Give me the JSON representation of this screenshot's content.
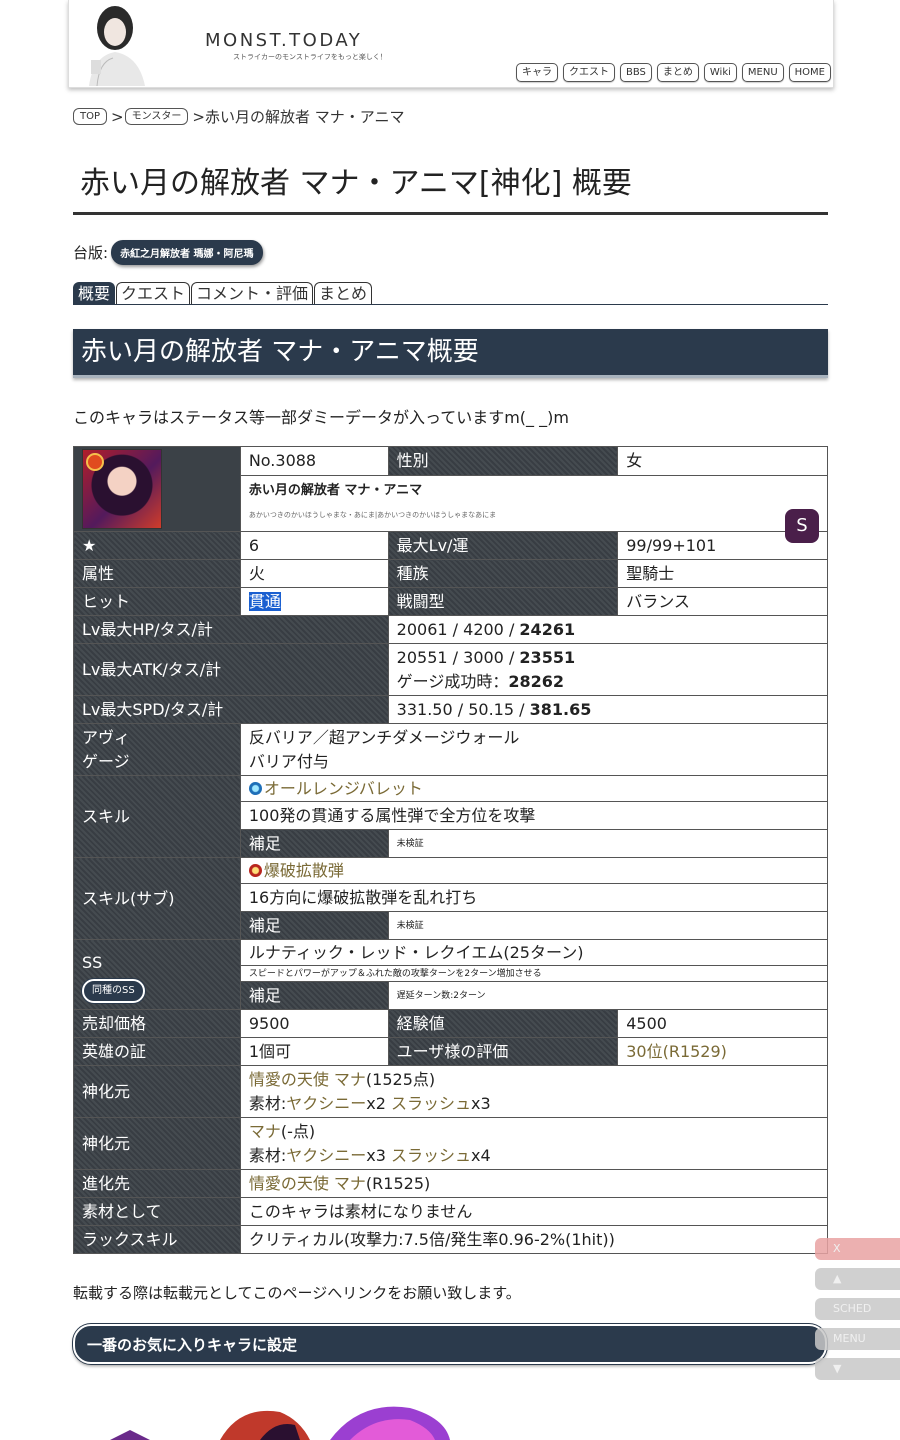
{
  "header": {
    "logo": "MONST.TODAY",
    "tagline": "ストライカーのモンストライフをもっと楽しく！",
    "nav": [
      "キャラ",
      "クエスト",
      "BBS",
      "まとめ",
      "Wiki",
      "MENU",
      "HOME"
    ]
  },
  "breadcrumb": {
    "top": "TOP",
    "sep": ">",
    "monster": "モンスター",
    "current": ">赤い月の解放者 マナ・アニマ"
  },
  "page_title": "赤い月の解放者 マナ・アニマ[神化] 概要",
  "source": {
    "label": "台版:",
    "badge": "赤紅之月解放者 瑪娜・阿尼瑪"
  },
  "tabs": [
    "概要",
    "クエスト",
    "コメント・評価",
    "まとめ"
  ],
  "section_title": "赤い月の解放者 マナ・アニマ概要",
  "notice": "このキャラはステータス等一部ダミーデータが入っていますm(_ _)m",
  "char": {
    "no": "No.3088",
    "gender_label": "性別",
    "gender": "女",
    "name": "赤い月の解放者 マナ・アニマ",
    "reading": "あかいつきのかいほうしゃまな・あにま|あかいつきのかいほうしゃまなあにま",
    "rank_badge": "S",
    "star_label": "★",
    "star": "6",
    "maxlv_label": "最大Lv/運",
    "maxlv": "99/99+101",
    "attr_label": "属性",
    "attr": "火",
    "tribe_label": "種族",
    "tribe": "聖騎士",
    "hit_label": "ヒット",
    "hit": "貫通",
    "battle_label": "戦闘型",
    "battle": "バランス",
    "hp_label": "Lv最大HP/タス/計",
    "hp_base": "20061 / 4200 / ",
    "hp_total": "24261",
    "atk_label": "Lv最大ATK/タス/計",
    "atk_base": "20551 / 3000 / ",
    "atk_total": "23551",
    "atk_gauge_label": "ゲージ成功時：",
    "atk_gauge": "28262",
    "spd_label": "Lv最大SPD/タス/計",
    "spd_base": "331.50 / 50.15 / ",
    "spd_total": "381.65",
    "ability_label_1": "アヴィ",
    "ability_label_2": "ゲージ",
    "ability_1": "反バリア／超アンチダメージウォール",
    "ability_2": "バリア付与",
    "skill_label": "スキル",
    "skill_name": "オールレンジバレット",
    "skill_desc": "100発の貫通する属性弾で全方位を攻撃",
    "supp_label": "補足",
    "skill_supp": "未検証",
    "subskill_label": "スキル(サブ)",
    "subskill_name": "爆破拡散弾",
    "subskill_desc": "16方向に爆破拡散弾を乱れ打ち",
    "subskill_supp": "未検証",
    "ss_label": "SS",
    "ss_button": "同種のSS",
    "ss_name": "ルナティック・レッド・レクイエム(25ターン)",
    "ss_desc": "スピードとパワーがアップ＆ふれた敵の攻撃ターンを2ターン増加させる",
    "ss_supp": "遅延ターン数:2ターン",
    "sell_label": "売却価格",
    "sell": "9500",
    "exp_label": "経験値",
    "exp": "4500",
    "hero_label": "英雄の証",
    "hero": "1個可",
    "rating_label": "ユーザ様の評価",
    "rating": "30位(R1529)",
    "origin_label": "神化元",
    "origin1_name": "情愛の天使 マナ",
    "origin1_pts": "(1525点)",
    "origin1_mat_label": "素材:",
    "origin1_mat1": "ヤクシニー",
    "origin1_mat1_qty": "x2 ",
    "origin1_mat2": "スラッシュ",
    "origin1_mat2_qty": "x3",
    "origin2_name": "マナ",
    "origin2_pts": "(-点)",
    "origin2_mat1": "ヤクシニー",
    "origin2_mat1_qty": "x3 ",
    "origin2_mat2": "スラッシュ",
    "origin2_mat2_qty": "x4",
    "evolve_label": "進化先",
    "evolve_name": "情愛の天使 マナ",
    "evolve_r": "(R1525)",
    "material_label": "素材として",
    "material": "このキャラは素材になりません",
    "luck_label": "ラックスキル",
    "luck": "クリティカル(攻撃力:7.5倍/発生率0.96-2%(1hit))"
  },
  "footnote": "転載する際は転載元としてこのページへリンクをお願い致します。",
  "fav_button": "一番のお気に入りキャラに設定",
  "side_buttons": [
    "X",
    "▲",
    "SCHED",
    "MENU",
    "▼"
  ]
}
